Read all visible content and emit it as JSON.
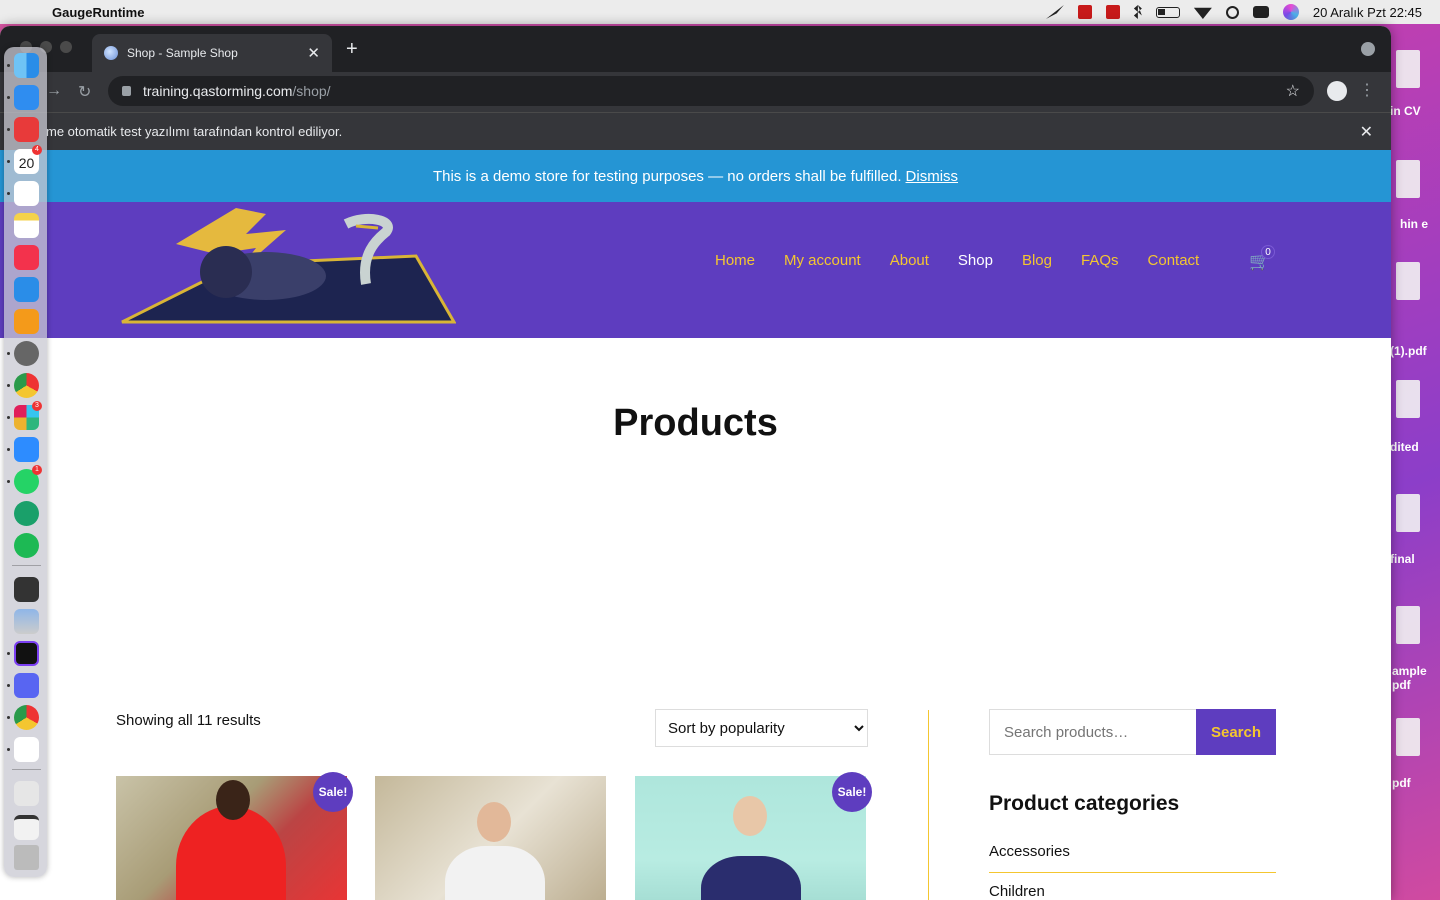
{
  "menubar": {
    "app_name": "GaugeRuntime",
    "datetime": "20 Aralık Pzt  22:45"
  },
  "desktop": {
    "labels": [
      "in CV",
      "hin e",
      "(1).pdf",
      "dited",
      "final",
      "ample pdf",
      "pdf"
    ]
  },
  "browser": {
    "tab_title": "Shop - Sample Shop",
    "url_host": "training.qastorming.com",
    "url_path": "/shop/",
    "automation_notice": "me otomatik test yazılımı tarafından kontrol ediliyor."
  },
  "site": {
    "demo_notice": "This is a demo store for testing purposes — no orders shall be fulfilled.",
    "dismiss_label": "Dismiss",
    "nav": [
      {
        "label": "Home"
      },
      {
        "label": "My account"
      },
      {
        "label": "About"
      },
      {
        "label": "Shop"
      },
      {
        "label": "Blog"
      },
      {
        "label": "FAQs"
      },
      {
        "label": "Contact"
      }
    ],
    "cart_count": "0",
    "colors": {
      "header": "#5e3dbf",
      "accent": "#f4c630",
      "notice": "#2595d4"
    }
  },
  "shop": {
    "page_title": "Products",
    "result_count": "Showing all 11 results",
    "sort_selected": "Sort by popularity",
    "sale_label": "Sale!"
  },
  "sidebar": {
    "search_placeholder": "Search products…",
    "search_button": "Search",
    "categories_title": "Product categories",
    "categories": [
      "Accessories",
      "Children"
    ]
  },
  "dock": {
    "calendar_day": "20",
    "badges": [
      "4",
      "3",
      "1"
    ]
  }
}
